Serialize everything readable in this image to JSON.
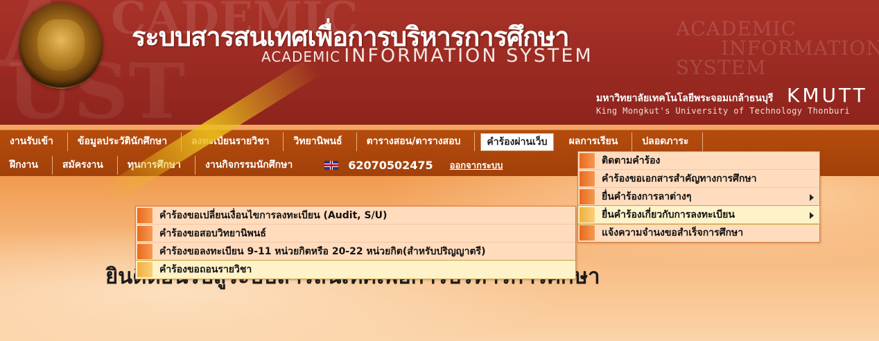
{
  "header": {
    "title_th": "ระบบสารสนเทศเพื่อการบริหารการศึกษา",
    "title_en_small": "ACADEMIC",
    "title_en_big": "INFORMATION SYSTEM",
    "ghost_right": [
      "ACADEMIC",
      "INFORMATION",
      "SYSTEM"
    ],
    "univ_th": "มหาวิทยาลัยเทคโนโลยีพระจอมเกล้าธนบุรี",
    "univ_abbr": "KMUTT",
    "univ_en": "King Mongkut's University of Technology Thonburi"
  },
  "nav": {
    "row1": [
      "งานรับเข้า",
      "ข้อมูลประวัตินักศึกษา",
      "ลงทะเบียนรายวิชา",
      "วิทยานิพนธ์",
      "ตารางสอน/ตารางสอบ",
      "คำร้องผ่านเว็บ",
      "ผลการเรียน",
      "ปลอดภาระ"
    ],
    "row2": [
      "ฝึกงาน",
      "สมัครงาน",
      "ทุนการศึกษา",
      "งานกิจกรรมนักศึกษา"
    ],
    "student_id": "62070502475",
    "logout": "ออกจากระบบ"
  },
  "dropdown_main": [
    "ติดตามคำร้อง",
    "คำร้องขอเอกสารสำคัญทางการศึกษา",
    "ยื่นคำร้องการลาต่างๆ",
    "ยื่นคำร้องเกี่ยวกับการลงทะเบียน",
    "แจ้งความจำนงขอสำเร็จการศึกษา"
  ],
  "dropdown_sub": [
    "คำร้องขอเปลี่ยนเงื่อนไขการลงทะเบียน (Audit, S/U)",
    "คำร้องขอสอบวิทยานิพนธ์",
    "คำร้องขอลงทะเบียน 9-11 หน่วยกิตหรือ 20-22 หน่วยกิต(สำหรับปริญญาตรี)",
    "คำร้องขอถอนรายวิชา"
  ],
  "welcome": "ยินดีต้อนรับสู่ระบบสารสนเทศเพื่อการบริหารการศึกษา"
}
